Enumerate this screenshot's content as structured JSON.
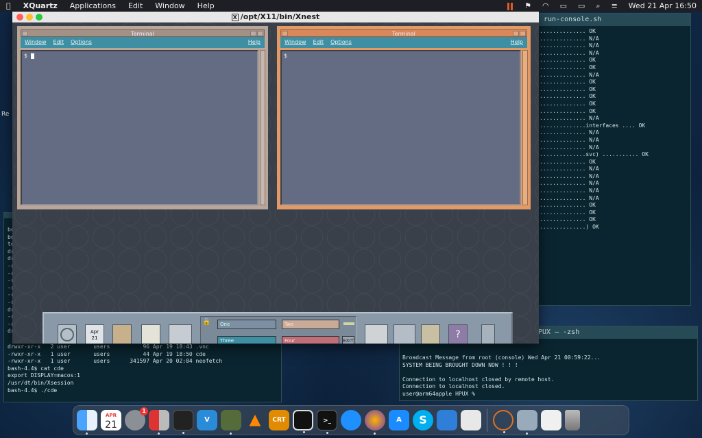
{
  "menubar": {
    "app": "XQuartz",
    "items": [
      "Applications",
      "Edit",
      "Window",
      "Help"
    ],
    "datetime": "Wed 21 Apr  16:50"
  },
  "xnest": {
    "title": "/opt/X11/bin/Xnest"
  },
  "cde_left": {
    "title": "Terminal",
    "menu": [
      "Window",
      "Edit",
      "Options"
    ],
    "help": "Help",
    "prompt": "$"
  },
  "cde_right": {
    "title": "Terminal",
    "menu": [
      "Window",
      "Edit",
      "Options"
    ],
    "help": "Help",
    "prompt": "$"
  },
  "frontpanel": {
    "workspaces": [
      "One",
      "Two",
      "Three",
      "Four"
    ],
    "exit": "EXIT",
    "cal_month": "Apr",
    "cal_day": "21"
  },
  "console": {
    "title": "run-console.sh",
    "lines": [
      ". OK",
      ". N/A",
      ". N/A",
      ". N/A",
      ". OK",
      ". OK",
      ". N/A",
      ". OK",
      ". OK",
      ". OK",
      ". OK",
      ". OK",
      ". N/A",
      "interfaces .... OK",
      ". N/A",
      ". N/A",
      ". N/A",
      "svc) ........... OK",
      ". OK",
      ". N/A",
      ". N/A",
      ". N/A",
      ". N/A",
      ". N/A",
      ". OK",
      ". OK",
      ". OK",
      ") OK"
    ]
  },
  "bash": {
    "side": [
      "bo",
      "bo",
      "to",
      "dr",
      "dr",
      "-r",
      "-r",
      "-r",
      "-r",
      "-r",
      "-r",
      "dr",
      "-r",
      "-r",
      "dr"
    ],
    "lines": [
      "drwxr-xr-x   2 user       users          96 Apr 19 18:43 .vnc",
      "-rwxr-xr-x   1 user       users          44 Apr 19 18:50 cde",
      "-rwxr-xr-x   1 user       users      341597 Apr 20 02:04 neofetch",
      "bash-4.4$ cat cde",
      "export DISPLAY=macos:1",
      "/usr/dt/bin/Xsession",
      "bash-4.4$ ./cde"
    ]
  },
  "hpux": {
    "title": "HPUX — -zsh",
    "lines": [
      "Broadcast Message from root (console) Wed Apr 21 00:59:22...",
      "SYSTEM BEING BROUGHT DOWN NOW ! ! !",
      "",
      "Connection to localhost closed by remote host.",
      "Connection to localhost closed.",
      "user@arm64apple HPUX % "
    ]
  },
  "side_label": "Re",
  "dock": {
    "cal_month": "APR",
    "cal_day": "21",
    "badge": "1",
    "apps": [
      "Finder",
      "Calendar",
      "System Preferences",
      "Parallels",
      "Activity Monitor",
      "VNC Viewer",
      "Sheep",
      "VLC",
      "CRT",
      "Cube",
      "Terminal",
      "Safari",
      "Firefox",
      "App Store",
      "Skype",
      "Xcode",
      "Preview",
      "XQuartz",
      "Preview",
      "Notes",
      "Trash"
    ]
  }
}
